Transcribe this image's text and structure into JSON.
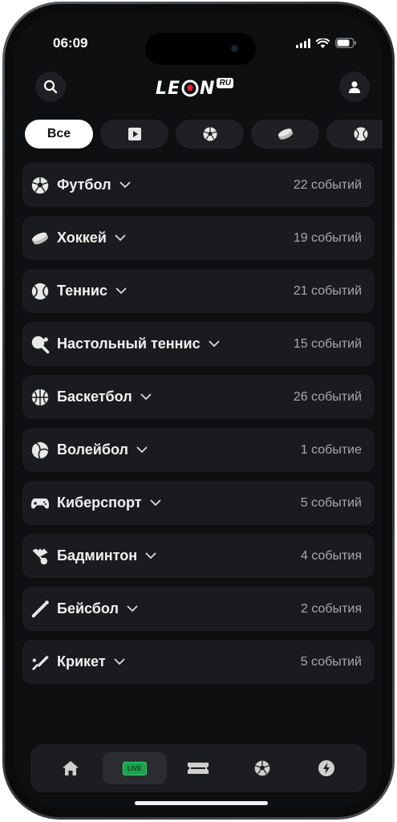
{
  "status_bar": {
    "time": "06:09"
  },
  "header": {
    "logo_text": "LE",
    "logo_text_end": "N",
    "logo_badge": "RU"
  },
  "filters": [
    {
      "label": "Все",
      "icon": "all",
      "active": true
    },
    {
      "label": "",
      "icon": "play-icon",
      "active": false
    },
    {
      "label": "",
      "icon": "soccer-ball-icon",
      "active": false
    },
    {
      "label": "",
      "icon": "hockey-puck-icon",
      "active": false
    },
    {
      "label": "",
      "icon": "tennis-ball-icon",
      "active": false
    }
  ],
  "sports": [
    {
      "name": "Футбол",
      "count": "22 событий",
      "icon": "soccer-ball-icon"
    },
    {
      "name": "Хоккей",
      "count": "19 событий",
      "icon": "hockey-puck-icon"
    },
    {
      "name": "Теннис",
      "count": "21 событий",
      "icon": "tennis-ball-icon"
    },
    {
      "name": "Настольный теннис",
      "count": "15 событий",
      "icon": "table-tennis-icon"
    },
    {
      "name": "Баскетбол",
      "count": "26 событий",
      "icon": "basketball-icon"
    },
    {
      "name": "Волейбол",
      "count": "1 событие",
      "icon": "volleyball-icon"
    },
    {
      "name": "Киберспорт",
      "count": "5 событий",
      "icon": "gamepad-icon"
    },
    {
      "name": "Бадминтон",
      "count": "4 события",
      "icon": "shuttlecock-icon"
    },
    {
      "name": "Бейсбол",
      "count": "2 события",
      "icon": "baseball-bat-icon"
    },
    {
      "name": "Крикет",
      "count": "5 событий",
      "icon": "cricket-bat-icon"
    }
  ],
  "tabbar": {
    "items": [
      {
        "icon": "home-icon",
        "active": false
      },
      {
        "icon": "live-icon",
        "label": "LIVE",
        "active": true
      },
      {
        "icon": "ticket-icon",
        "active": false
      },
      {
        "icon": "soccer-ball-icon",
        "active": false
      },
      {
        "icon": "lightning-icon",
        "active": false
      }
    ]
  },
  "colors": {
    "background": "#0e0f11",
    "row": "#1a1b1e",
    "accent_live": "#1fa04d",
    "count_text": "#a7a9ad"
  }
}
